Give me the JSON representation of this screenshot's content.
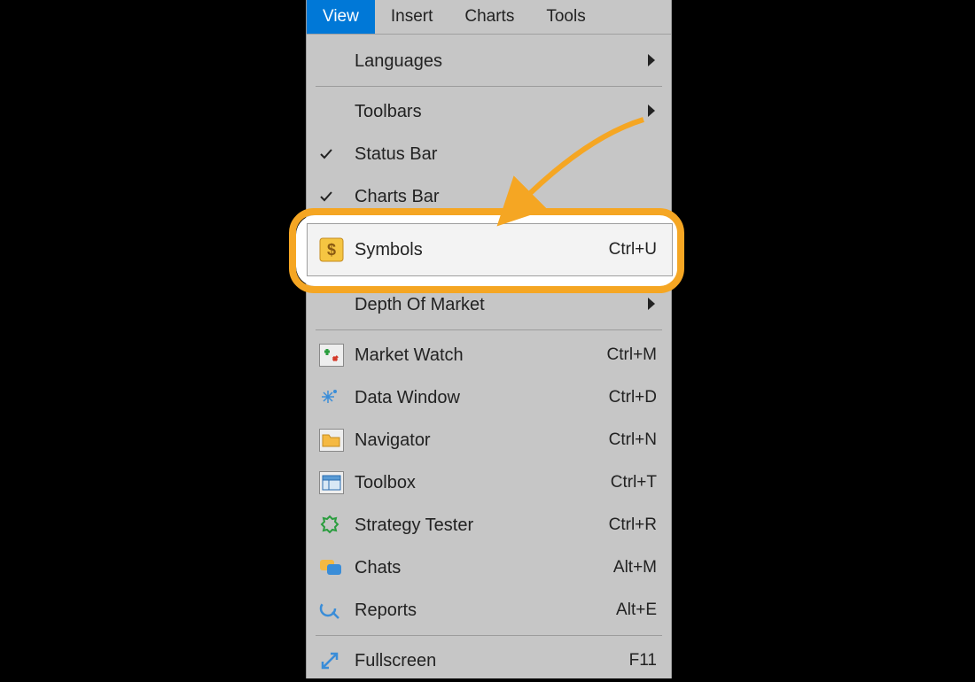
{
  "menubar": {
    "items": [
      {
        "label": "View",
        "active": true
      },
      {
        "label": "Insert",
        "active": false
      },
      {
        "label": "Charts",
        "active": false
      },
      {
        "label": "Tools",
        "active": false
      }
    ]
  },
  "menu": {
    "languages": {
      "label": "Languages"
    },
    "toolbars": {
      "label": "Toolbars"
    },
    "status_bar": {
      "label": "Status Bar"
    },
    "charts_bar": {
      "label": "Charts Bar"
    },
    "symbols": {
      "label": "Symbols",
      "shortcut": "Ctrl+U"
    },
    "depth_of_market": {
      "label": "Depth Of Market"
    },
    "market_watch": {
      "label": "Market Watch",
      "shortcut": "Ctrl+M"
    },
    "data_window": {
      "label": "Data Window",
      "shortcut": "Ctrl+D"
    },
    "navigator": {
      "label": "Navigator",
      "shortcut": "Ctrl+N"
    },
    "toolbox": {
      "label": "Toolbox",
      "shortcut": "Ctrl+T"
    },
    "strategy_tester": {
      "label": "Strategy Tester",
      "shortcut": "Ctrl+R"
    },
    "chats": {
      "label": "Chats",
      "shortcut": "Alt+M"
    },
    "reports": {
      "label": "Reports",
      "shortcut": "Alt+E"
    },
    "fullscreen": {
      "label": "Fullscreen",
      "shortcut": "F11"
    }
  },
  "icons": {
    "symbols": "dollar-icon",
    "market_watch": "market-watch-icon",
    "data_window": "sparkle-icon",
    "navigator": "folder-icon",
    "toolbox": "toolbox-icon",
    "strategy_tester": "gear-badge-icon",
    "chats": "chat-icon",
    "reports": "report-icon",
    "fullscreen": "expand-icon"
  },
  "annotation": {
    "highlight_color": "#f5a623",
    "arrow_color": "#f5a623"
  }
}
